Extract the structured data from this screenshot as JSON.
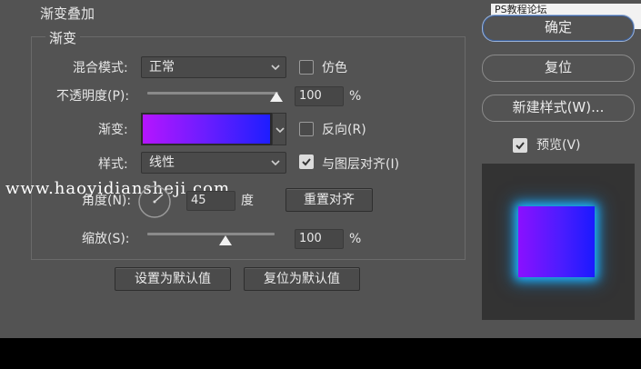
{
  "dialog": {
    "section_title": "渐变叠加",
    "group_title": "渐变",
    "blend_mode": {
      "label": "混合模式:",
      "value": "正常"
    },
    "dither": {
      "label": "仿色",
      "checked": false
    },
    "opacity": {
      "label": "不透明度(P):",
      "value": "100",
      "unit": "%",
      "level_percent": 100
    },
    "gradient": {
      "label": "渐变:",
      "colors": [
        "#b515ff",
        "#6a1dff",
        "#1e1eff"
      ]
    },
    "reverse": {
      "label": "反向(R)",
      "checked": false
    },
    "style": {
      "label": "样式:",
      "value": "线性"
    },
    "align_layer": {
      "label": "与图层对齐(I)",
      "checked": true
    },
    "angle": {
      "label": "角度(N):",
      "value": "45",
      "unit": "度"
    },
    "reset_align_button": "重置对齐",
    "scale": {
      "label": "缩放(S):",
      "value": "100",
      "unit": "%",
      "level_percent": 100
    },
    "set_default_button": "设置为默认值",
    "reset_default_button": "复位为默认值"
  },
  "side": {
    "ok_button": "确定",
    "reset_button": "复位",
    "new_style_button": "新建样式(W)...",
    "preview": {
      "label": "预览(V)",
      "checked": true
    }
  },
  "watermarks": {
    "top_right": "PS教程论坛 WWW.16XX8.COM",
    "middle": "www.haoyidiansheji.com"
  },
  "colors": {
    "panel": "#535353",
    "preview_glow": "#1bb7ff"
  }
}
